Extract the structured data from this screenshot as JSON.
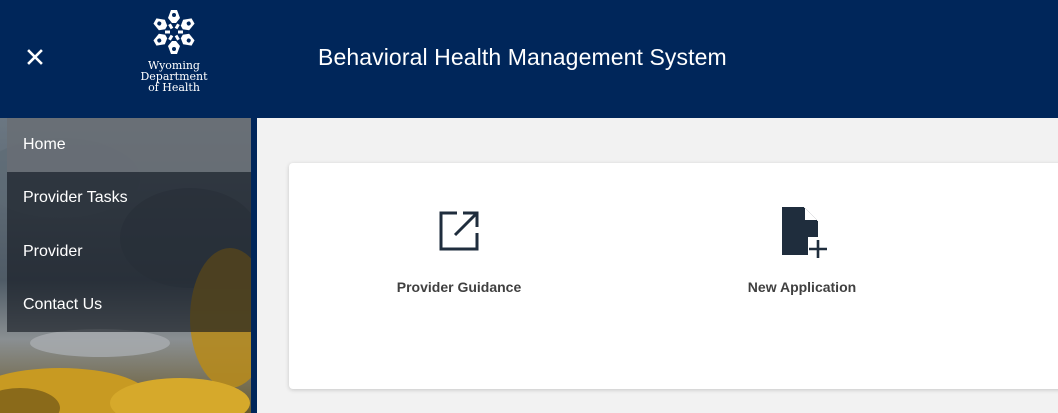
{
  "header": {
    "title": "Behavioral Health Management System",
    "close_icon": "close-icon",
    "logo": {
      "line1": "Wyoming",
      "line2": "Department",
      "line3": "of Health"
    },
    "background": "#00265a"
  },
  "sidebar": {
    "items": [
      {
        "label": "Home",
        "active": true
      },
      {
        "label": "Provider Tasks",
        "active": false
      },
      {
        "label": "Provider",
        "active": false
      },
      {
        "label": "Contact Us",
        "active": false
      }
    ]
  },
  "dashboard": {
    "tiles": [
      {
        "label": "Provider Guidance",
        "icon": "open-in-new-icon"
      },
      {
        "label": "New Application",
        "icon": "file-add-icon"
      }
    ]
  },
  "colors": {
    "accent": "#00265a",
    "icon": "#1f2d3d",
    "label": "#404040"
  }
}
